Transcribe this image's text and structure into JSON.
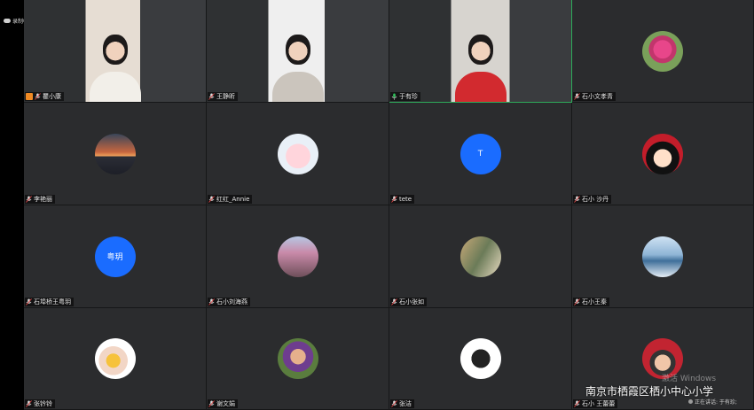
{
  "recording": {
    "label": "录制中"
  },
  "participants": [
    {
      "name": "瞿小康",
      "type": "video",
      "host": true,
      "mic": "off"
    },
    {
      "name": "王静昕",
      "type": "video",
      "mic": "off"
    },
    {
      "name": "于有珍",
      "type": "video",
      "mic": "on",
      "speaking": true
    },
    {
      "name": "石小文孝青",
      "type": "avatar",
      "avatar": "pink-flower",
      "mic": "off"
    },
    {
      "name": "李艳丽",
      "type": "avatar",
      "avatar": "sunset",
      "mic": "off"
    },
    {
      "name": "红红_Annie",
      "type": "avatar",
      "avatar": "cartoon-pig",
      "mic": "off"
    },
    {
      "name": "tete",
      "type": "letter",
      "letter": "T",
      "mic": "off"
    },
    {
      "name": "石小 沙丹",
      "type": "avatar",
      "avatar": "cartoon-girl",
      "mic": "off"
    },
    {
      "name": "石埠桥王粤玥",
      "type": "letter",
      "letter": "粤玥",
      "mic": "off"
    },
    {
      "name": "石小刘海燕",
      "type": "avatar",
      "avatar": "plum-blossom",
      "mic": "off"
    },
    {
      "name": "石小张如",
      "type": "avatar",
      "avatar": "painting",
      "mic": "off"
    },
    {
      "name": "石小王秦",
      "type": "avatar",
      "avatar": "lake",
      "mic": "off"
    },
    {
      "name": "张钤铃",
      "type": "avatar",
      "avatar": "girl-flower",
      "mic": "off"
    },
    {
      "name": "谢文娟",
      "type": "avatar",
      "avatar": "child-photo",
      "mic": "off"
    },
    {
      "name": "张洁",
      "type": "avatar",
      "avatar": "silhouette",
      "mic": "off"
    },
    {
      "name": "石小 王蕾蕾",
      "type": "avatar",
      "avatar": "cartoon-red",
      "mic": "off"
    }
  ],
  "overlay": {
    "watermark": "激活 Windows",
    "school": "南京市栖霞区栖小中心小学",
    "speaking_label": "正在讲话: 于有珍;"
  },
  "colors": {
    "tile_bg": "#2b2c2e",
    "letter_avatar": "#1a6cff",
    "speaking_border": "#2eab5a",
    "host_icon": "#f08a24"
  }
}
